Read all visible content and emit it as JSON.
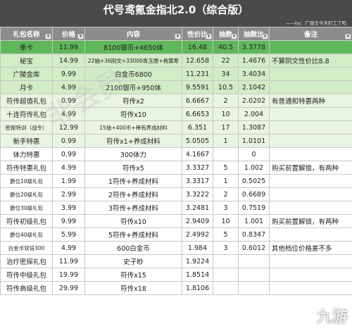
{
  "header": {
    "title": "代号鸢氪金指北2.0（综合版）",
    "credit": "——by：广陵王今天打工了吗"
  },
  "columns": [
    "礼包名称",
    "价格",
    "内容",
    "性价比",
    "抽数",
    "抽数比",
    "备注"
  ],
  "rows": [
    {
      "name": "季卡",
      "price": "11.99",
      "content": "8100银币+4650体",
      "ratio": "16.48",
      "pulls": "40.5",
      "pull_ratio": "3.3778",
      "note": "",
      "style": "hl"
    },
    {
      "name": "秘宝",
      "price": "14.99",
      "content": "22抽+36阴文+33000青玉匣+骨算筹",
      "ratio": "12.658",
      "pulls": "22",
      "pull_ratio": "1.4676",
      "note": "不算阴文性价比8.8",
      "style": "g1"
    },
    {
      "name": "广陵金库",
      "price": "9.99",
      "content": "白金币6800",
      "ratio": "11.231",
      "pulls": "34",
      "pull_ratio": "3.4034",
      "note": "",
      "style": "g1"
    },
    {
      "name": "月卡",
      "price": "4.99",
      "content": "2100银币+950体",
      "ratio": "9.5591",
      "pulls": "10.5",
      "pull_ratio": "2.1042",
      "note": "",
      "style": "g1"
    },
    {
      "name": "符传超值礼包",
      "price": "0.99",
      "content": "符传x2",
      "ratio": "6.6667",
      "pulls": "2",
      "pull_ratio": "2.0202",
      "note": "有普通和特惠两种",
      "style": "g2"
    },
    {
      "name": "十连符传礼包",
      "price": "4.99",
      "content": "符传x10",
      "ratio": "6.6653",
      "pulls": "10",
      "pull_ratio": "2.004",
      "note": "",
      "style": "g2"
    },
    {
      "name": "密探特训（战令）",
      "price": "12.99",
      "content": "15抽+400币+稀有养成材料",
      "ratio": "6.351",
      "pulls": "17",
      "pull_ratio": "1.3087",
      "note": "",
      "style": "g2"
    },
    {
      "name": "新手特惠",
      "price": "0.99",
      "content": "符传x1+养成材料",
      "ratio": "5.0505",
      "pulls": "1",
      "pull_ratio": "1.0101",
      "note": "",
      "style": "g2"
    },
    {
      "name": "体力特惠",
      "price": "0.99",
      "content": "300体力",
      "ratio": "4.1667",
      "pulls": "",
      "pull_ratio": "0",
      "note": "",
      "style": "w"
    },
    {
      "name": "符传特惠礼包",
      "price": "4.99",
      "content": "符传x5",
      "ratio": "3.3327",
      "pulls": "5",
      "pull_ratio": "1.002",
      "note": "购买前置解锁，有两种",
      "style": "w"
    },
    {
      "name": "爵位10级礼包",
      "price": "1.99",
      "content": "1符传+养成材料",
      "ratio": "3.3317",
      "pulls": "1",
      "pull_ratio": "0.5025",
      "note": "",
      "style": "w"
    },
    {
      "name": "爵位20级礼包",
      "price": "2.99",
      "content": "2符传+养成材料",
      "ratio": "3.3222",
      "pulls": "2",
      "pull_ratio": "0.6689",
      "note": "",
      "style": "w"
    },
    {
      "name": "爵位30级礼包",
      "price": "3.99",
      "content": "3符传+养成材料",
      "ratio": "3.2481",
      "pulls": "3",
      "pull_ratio": "0.7519",
      "note": "",
      "style": "w"
    },
    {
      "name": "符传初级礼包",
      "price": "9.99",
      "content": "符传x10",
      "ratio": "2.9409",
      "pulls": "10",
      "pull_ratio": "1.001",
      "note": "购买前置解锁，有两种",
      "style": "w"
    },
    {
      "name": "爵位40级礼包",
      "price": "5.99",
      "content": "5符传+养成材料",
      "ratio": "2.4992",
      "pulls": "5",
      "pull_ratio": "0.8347",
      "note": "",
      "style": "w"
    },
    {
      "name": "白金币双倍300",
      "price": "4.99",
      "content": "600白金币",
      "ratio": "1.984",
      "pulls": "3",
      "pull_ratio": "0.6012",
      "note": "其他档位价格差不多",
      "style": "w"
    },
    {
      "name": "治疗密探礼包",
      "price": "11.99",
      "content": "史子眇",
      "ratio": "1.9224",
      "pulls": "",
      "pull_ratio": "",
      "note": "",
      "style": "w"
    },
    {
      "name": "符传中级礼包",
      "price": "19.99",
      "content": "符传x15",
      "ratio": "1.8514",
      "pulls": "",
      "pull_ratio": "",
      "note": "",
      "style": "w"
    },
    {
      "name": "符传高级礼包",
      "price": "29.99",
      "content": "符传x18",
      "ratio": "1.8106",
      "pulls": "",
      "pull_ratio": "",
      "note": "",
      "style": "w"
    }
  ],
  "watermark": "非会员",
  "logo": "九游"
}
